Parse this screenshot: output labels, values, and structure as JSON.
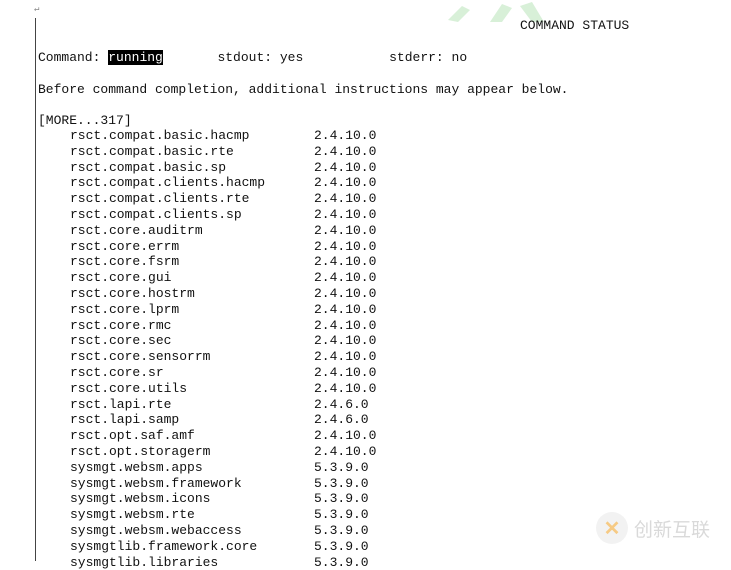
{
  "header": {
    "title": "COMMAND STATUS"
  },
  "status": {
    "command_label": "Command:",
    "command_value": "running",
    "stdout_label": "stdout:",
    "stdout_value": "yes",
    "stderr_label": "stderr:",
    "stderr_value": "no"
  },
  "note": "Before command completion, additional instructions may appear below.",
  "more": "[MORE...317]",
  "filesets": [
    {
      "name": "rsct.compat.basic.hacmp",
      "version": "2.4.10.0"
    },
    {
      "name": "rsct.compat.basic.rte",
      "version": "2.4.10.0"
    },
    {
      "name": "rsct.compat.basic.sp",
      "version": "2.4.10.0"
    },
    {
      "name": "rsct.compat.clients.hacmp",
      "version": "2.4.10.0"
    },
    {
      "name": "rsct.compat.clients.rte",
      "version": "2.4.10.0"
    },
    {
      "name": "rsct.compat.clients.sp",
      "version": "2.4.10.0"
    },
    {
      "name": "rsct.core.auditrm",
      "version": "2.4.10.0"
    },
    {
      "name": "rsct.core.errm",
      "version": "2.4.10.0"
    },
    {
      "name": "rsct.core.fsrm",
      "version": "2.4.10.0"
    },
    {
      "name": "rsct.core.gui",
      "version": "2.4.10.0"
    },
    {
      "name": "rsct.core.hostrm",
      "version": "2.4.10.0"
    },
    {
      "name": "rsct.core.lprm",
      "version": "2.4.10.0"
    },
    {
      "name": "rsct.core.rmc",
      "version": "2.4.10.0"
    },
    {
      "name": "rsct.core.sec",
      "version": "2.4.10.0"
    },
    {
      "name": "rsct.core.sensorrm",
      "version": "2.4.10.0"
    },
    {
      "name": "rsct.core.sr",
      "version": "2.4.10.0"
    },
    {
      "name": "rsct.core.utils",
      "version": "2.4.10.0"
    },
    {
      "name": "rsct.lapi.rte",
      "version": "2.4.6.0"
    },
    {
      "name": "rsct.lapi.samp",
      "version": "2.4.6.0"
    },
    {
      "name": "rsct.opt.saf.amf",
      "version": "2.4.10.0"
    },
    {
      "name": "rsct.opt.storagerm",
      "version": "2.4.10.0"
    },
    {
      "name": "sysmgt.websm.apps",
      "version": "5.3.9.0"
    },
    {
      "name": "sysmgt.websm.framework",
      "version": "5.3.9.0"
    },
    {
      "name": "sysmgt.websm.icons",
      "version": "5.3.9.0"
    },
    {
      "name": "sysmgt.websm.rte",
      "version": "5.3.9.0"
    },
    {
      "name": "sysmgt.websm.webaccess",
      "version": "5.3.9.0"
    },
    {
      "name": "sysmgtlib.framework.core",
      "version": "5.3.9.0"
    },
    {
      "name": "sysmgtlib.libraries",
      "version": "5.3.9.0"
    }
  ],
  "watermark": {
    "text": "创新互联",
    "icon": "x-logo-icon",
    "color": "#f0a020"
  }
}
